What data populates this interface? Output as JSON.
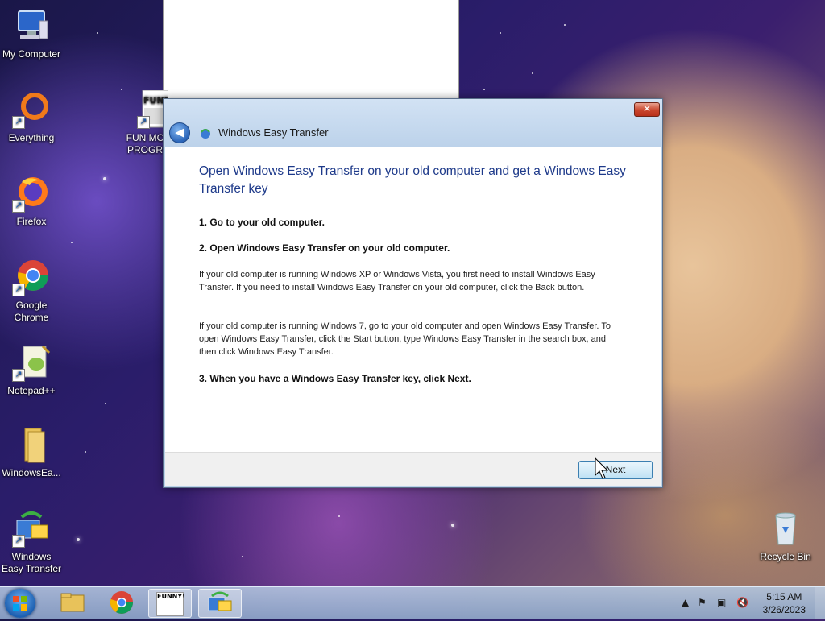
{
  "desktop": {
    "icons": [
      {
        "label": "My Computer",
        "icon": "computer-icon"
      },
      {
        "label": "Everything",
        "icon": "everything-icon"
      },
      {
        "label": "Firefox",
        "icon": "firefox-icon"
      },
      {
        "label": "Google Chrome",
        "icon": "chrome-icon"
      },
      {
        "label": "Notepad++",
        "icon": "notepadpp-icon"
      },
      {
        "label": "WindowsEa...",
        "icon": "folder-icon"
      },
      {
        "label": "Windows Easy Transfer",
        "icon": "easy-transfer-icon"
      },
      {
        "label": "FUN MC PROGR",
        "icon": "funny-image-icon"
      },
      {
        "label": "Recycle Bin",
        "icon": "recycle-bin-icon"
      }
    ]
  },
  "dialog": {
    "title": "Windows Easy Transfer",
    "close_label": "✕",
    "heading": "Open Windows Easy Transfer on your old computer and get a Windows Easy Transfer key",
    "step1": "1. Go to your old computer.",
    "step2": "2. Open Windows Easy Transfer on your old computer.",
    "para1": "If your old computer is running Windows XP or Windows Vista, you first need to install Windows Easy Transfer. If you need to install Windows Easy Transfer on your old computer, click the Back button.",
    "para2": "If your old computer is running Windows 7, go to your old computer and open Windows Easy Transfer. To open Windows Easy Transfer, click the Start button, type Windows Easy Transfer in the search box, and then click Windows Easy Transfer.",
    "step3": "3. When you have a Windows Easy Transfer key, click Next.",
    "next_label": "Next"
  },
  "taskbar": {
    "time": "5:15 AM",
    "date": "3/26/2023",
    "funny_label": "FUNNY!"
  },
  "colors": {
    "heading": "#1e3a8a",
    "titlebar": "#bcd3ea",
    "close": "#c9452c"
  }
}
